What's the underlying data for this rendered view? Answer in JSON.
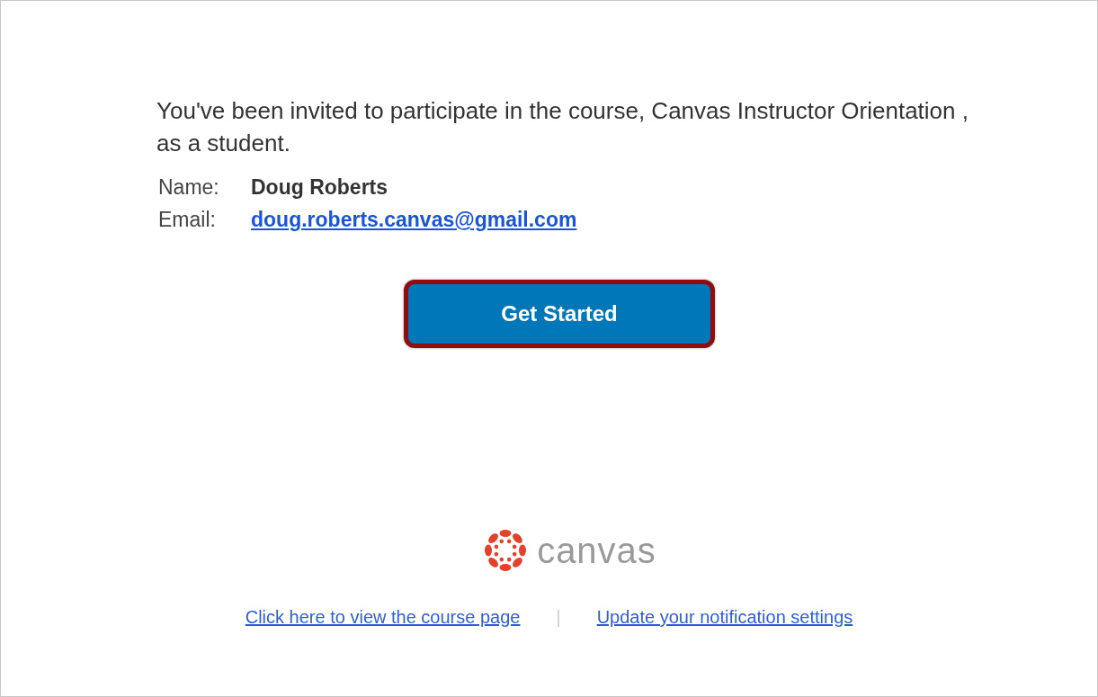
{
  "intro": "You've been invited to participate in the course, Canvas Instructor Orientation , as a student.",
  "details": [
    {
      "label": "Name:",
      "value": "Doug Roberts",
      "kind": "bold"
    },
    {
      "label": "Email:",
      "value": "doug.roberts.canvas@gmail.com",
      "kind": "link"
    }
  ],
  "button": {
    "label": "Get Started",
    "highlighted": true
  },
  "logo": {
    "wordmark": "canvas"
  },
  "footer": {
    "links": [
      "Click here to view the course page",
      "Update your notification settings"
    ],
    "separator": "|"
  }
}
